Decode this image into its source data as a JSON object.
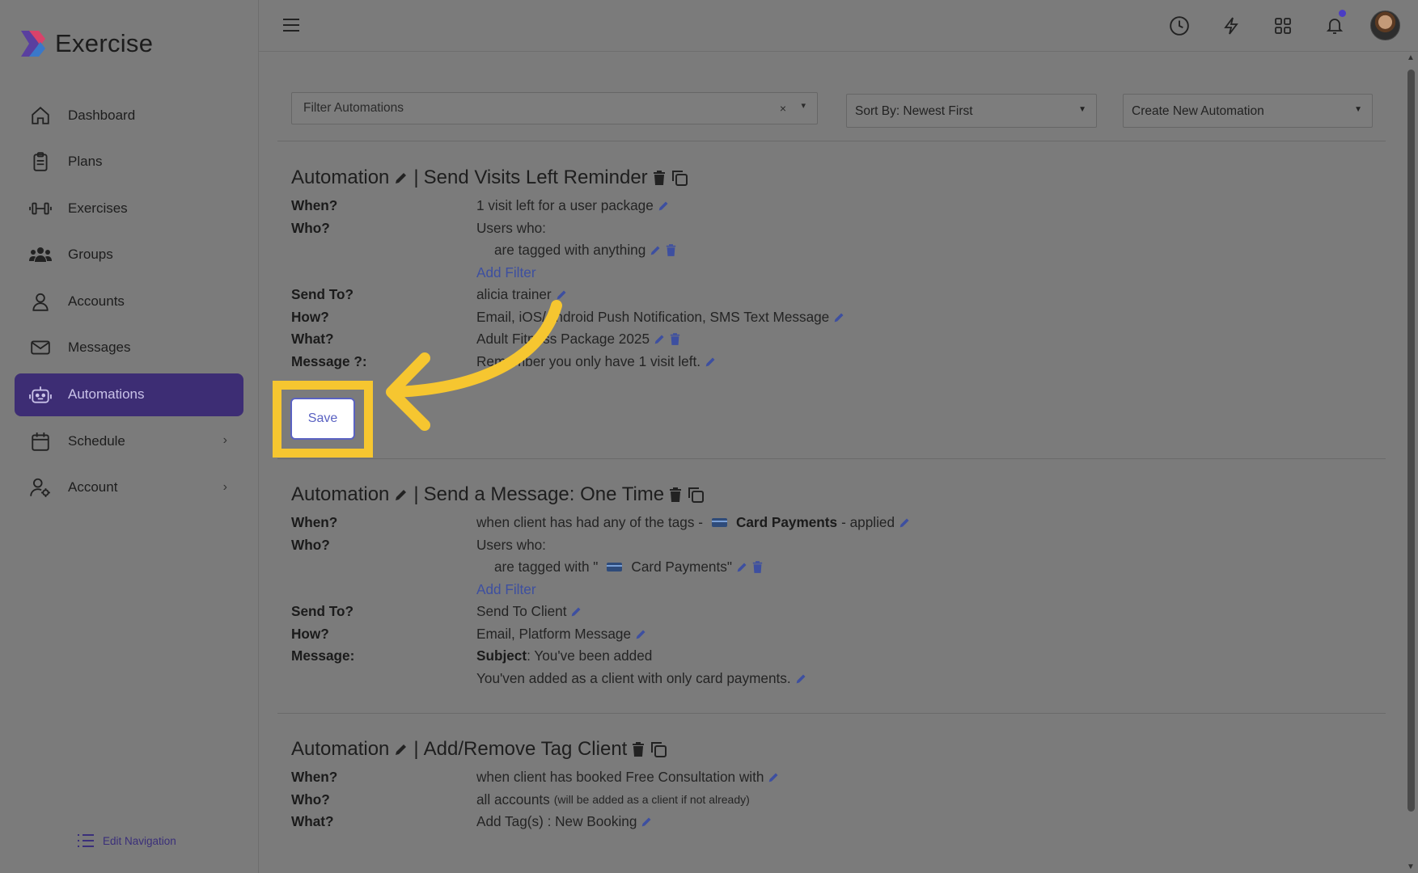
{
  "app": {
    "name": "Exercise"
  },
  "sidebar": {
    "items": [
      {
        "label": "Dashboard",
        "icon": "home-icon"
      },
      {
        "label": "Plans",
        "icon": "clipboard-icon"
      },
      {
        "label": "Exercises",
        "icon": "dumbbell-icon"
      },
      {
        "label": "Groups",
        "icon": "users-icon"
      },
      {
        "label": "Accounts",
        "icon": "user-icon"
      },
      {
        "label": "Messages",
        "icon": "envelope-icon"
      },
      {
        "label": "Automations",
        "icon": "robot-icon",
        "active": true
      },
      {
        "label": "Schedule",
        "icon": "calendar-icon",
        "has_submenu": true
      },
      {
        "label": "Account",
        "icon": "user-cog-icon",
        "has_submenu": true
      }
    ],
    "edit_navigation": "Edit Navigation"
  },
  "topbar": {
    "icons": [
      "menu-icon",
      "history-icon",
      "bolt-icon",
      "apps-grid-icon",
      "bell-icon",
      "avatar"
    ]
  },
  "filters": {
    "filter_placeholder": "Filter Automations",
    "clear": "×",
    "sort": "Sort By: Newest First",
    "create": "Create New Automation"
  },
  "automations": [
    {
      "title_prefix": "Automation",
      "title_sep": "|",
      "title": "Send Visits Left Reminder",
      "labels": {
        "when": "When?",
        "who": "Who?",
        "send_to": "Send To?",
        "how": "How?",
        "what": "What?",
        "message": "Message ?:"
      },
      "when": "1 visit left for a user package",
      "who": "Users who:",
      "who_filter": "are tagged with anything",
      "add_filter": "Add Filter",
      "send_to": "alicia trainer",
      "how": "Email, iOS/Android Push Notification, SMS Text Message",
      "what": "Adult Fitness Package 2025",
      "message": "Remember you only have 1 visit left.",
      "save": "Save"
    },
    {
      "title_prefix": "Automation",
      "title_sep": "|",
      "title": "Send a Message: One Time",
      "labels": {
        "when": "When?",
        "who": "Who?",
        "send_to": "Send To?",
        "how": "How?",
        "message": "Message:"
      },
      "when_prefix": "when client has had any of the tags -",
      "when_tag": "Card Payments",
      "when_suffix": "- applied",
      "who": "Users who:",
      "who_filter_prefix": "are tagged with \"",
      "who_filter_tag": "Card Payments\"",
      "add_filter": "Add Filter",
      "send_to": "Send To Client",
      "how": "Email, Platform Message",
      "subject_label": "Subject",
      "subject": ": You've been added",
      "message_body": "You'ven added as a client with only card payments."
    },
    {
      "title_prefix": "Automation",
      "title_sep": "|",
      "title": "Add/Remove Tag Client",
      "labels": {
        "when": "When?",
        "who": "Who?",
        "what": "What?"
      },
      "when": "when client has booked Free Consultation with",
      "who": "all accounts",
      "who_note": "(will be added as a client if not already)",
      "what": "Add Tag(s) : New Booking"
    }
  ],
  "colors": {
    "accent": "#3d2d74",
    "highlight": "#f6c630",
    "link": "#3d4fa0"
  }
}
